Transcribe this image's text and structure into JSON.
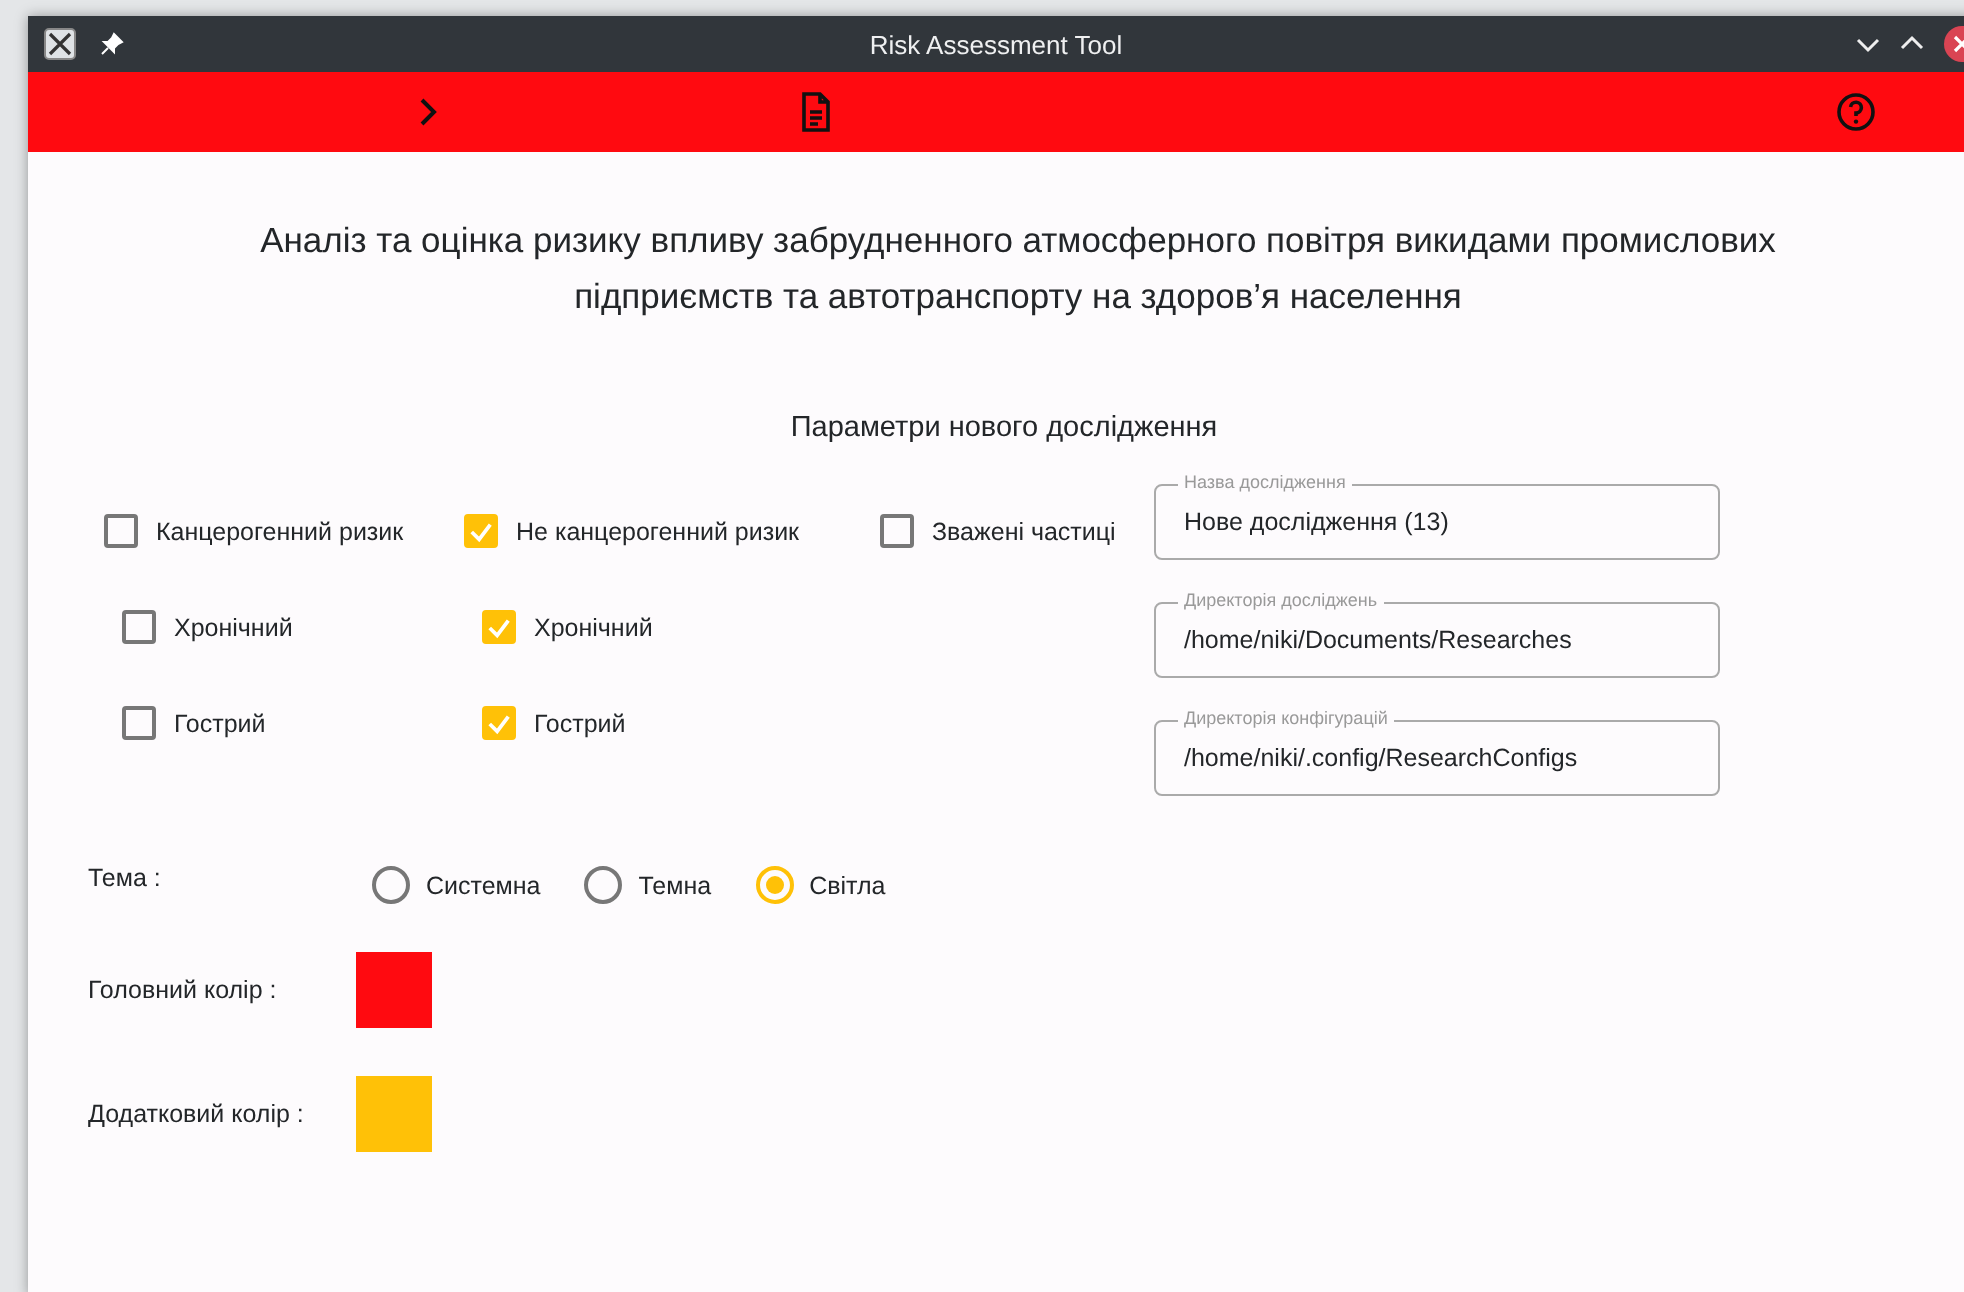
{
  "window": {
    "title": "Risk Assessment Tool"
  },
  "heading": "Аналіз та оцінка ризику впливу забрудненного атмосферного повітря викидами промислових підприємств та автотранспорту на здоров’я населення",
  "subheading": "Параметри нового дослідження",
  "risk_groups": [
    {
      "label": "Канцерогенний ризик",
      "checked": false,
      "children": [
        {
          "label": "Хронічний",
          "checked": false
        },
        {
          "label": "Гострий",
          "checked": false
        }
      ]
    },
    {
      "label": "Не канцерогенний ризик",
      "checked": true,
      "children": [
        {
          "label": "Хронічний",
          "checked": true
        },
        {
          "label": "Гострий",
          "checked": true
        }
      ]
    },
    {
      "label": "Зважені частиці",
      "checked": false
    }
  ],
  "fields": [
    {
      "label": "Назва дослідження",
      "value": "Нове дослідження (13)"
    },
    {
      "label": "Директорія досліджень",
      "value": "/home/niki/Documents/Researches"
    },
    {
      "label": "Директорія конфігурацій",
      "value": "/home/niki/.config/ResearchConfigs"
    }
  ],
  "theme": {
    "label": "Тема :",
    "options": [
      {
        "label": "Системна",
        "selected": false
      },
      {
        "label": "Темна",
        "selected": false
      },
      {
        "label": "Світла",
        "selected": true
      }
    ]
  },
  "colors": [
    {
      "label": "Головний колір :",
      "color": "#ff0a10"
    },
    {
      "label": "Додатковий колір :",
      "color": "#ffc107"
    }
  ]
}
